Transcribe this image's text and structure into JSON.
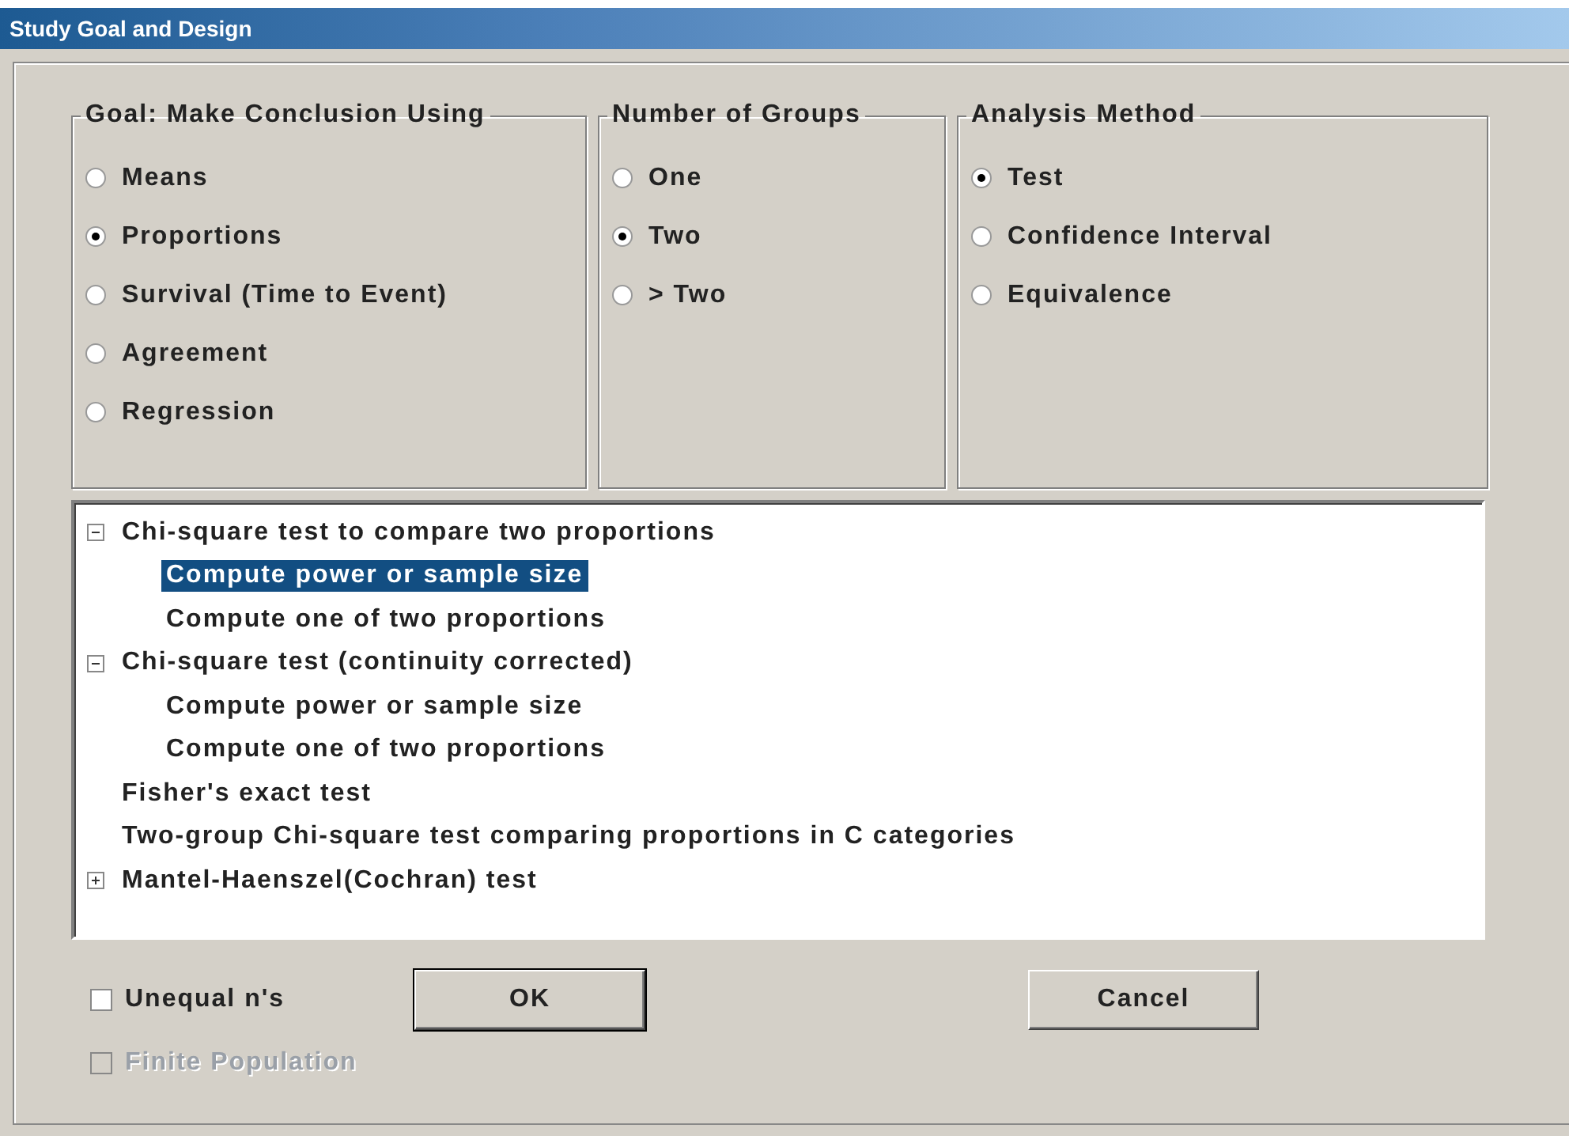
{
  "window": {
    "title": "Study Goal and Design"
  },
  "groups": [
    {
      "title": "Goal: Make Conclusion Using",
      "options": [
        {
          "label": "Means",
          "selected": false
        },
        {
          "label": "Proportions",
          "selected": true
        },
        {
          "label": "Survival (Time to Event)",
          "selected": false
        },
        {
          "label": "Agreement",
          "selected": false
        },
        {
          "label": "Regression",
          "selected": false
        }
      ]
    },
    {
      "title": "Number of Groups",
      "options": [
        {
          "label": "One",
          "selected": false
        },
        {
          "label": "Two",
          "selected": true
        },
        {
          "label": "> Two",
          "selected": false
        }
      ]
    },
    {
      "title": "Analysis Method",
      "options": [
        {
          "label": "Test",
          "selected": true
        },
        {
          "label": "Confidence Interval",
          "selected": false
        },
        {
          "label": "Equivalence",
          "selected": false
        }
      ]
    }
  ],
  "tree": [
    {
      "kind": "group",
      "label": "Chi-square test to compare two proportions",
      "expanded": true,
      "selected": false,
      "children": [
        {
          "kind": "item",
          "label": "Compute power or sample size",
          "selected": true
        },
        {
          "kind": "item",
          "label": "Compute one of two proportions",
          "selected": false
        }
      ]
    },
    {
      "kind": "group",
      "label": "Chi-square test (continuity corrected)",
      "expanded": true,
      "selected": false,
      "children": [
        {
          "kind": "item",
          "label": "Compute power or sample size",
          "selected": false
        },
        {
          "kind": "item",
          "label": "Compute one of two proportions",
          "selected": false
        }
      ]
    },
    {
      "kind": "item",
      "label": "Fisher's exact test",
      "selected": false
    },
    {
      "kind": "item",
      "label": "Two-group Chi-square test comparing proportions in C categories",
      "selected": false
    },
    {
      "kind": "group",
      "label": "Mantel-Haenszel(Cochran) test",
      "expanded": false,
      "selected": false
    }
  ],
  "checkboxes": [
    {
      "label": "Unequal n's",
      "checked": false,
      "disabled": false
    },
    {
      "label": "Finite Population",
      "checked": false,
      "disabled": true
    }
  ],
  "buttons": [
    {
      "label": "OK",
      "default": true
    },
    {
      "label": "Cancel",
      "default": false
    }
  ]
}
